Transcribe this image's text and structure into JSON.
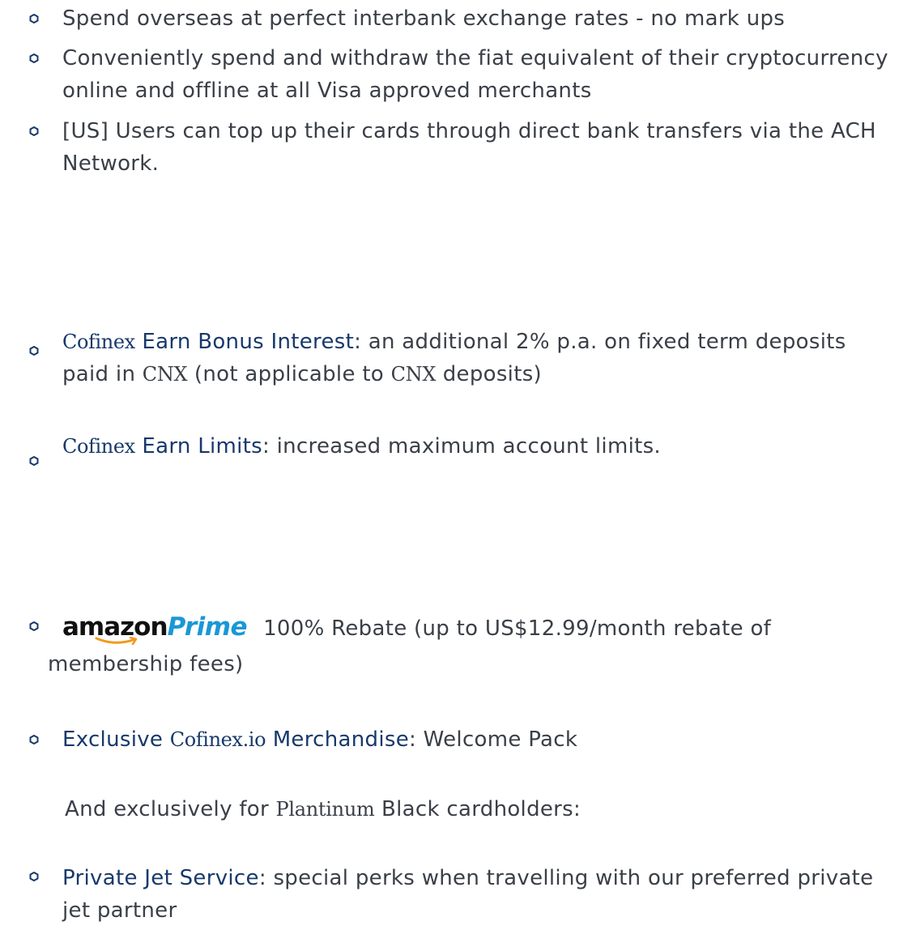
{
  "items": {
    "i1": "Spend overseas at perfect interbank exchange rates - no mark ups",
    "i2": "Conveniently spend and withdraw the fiat equivalent of their cryptocurrency online and offline at all Visa approved merchants",
    "i3": "[US] Users can top up their cards through direct bank transfers via the ACH Network.",
    "i4": {
      "brand": "Cofinex",
      "title": "Earn Bonus Interest",
      "text_a": ": an additional 2% p.a. on fixed term deposits paid in ",
      "token1": "CNX",
      "text_b": " (not applicable to ",
      "token2": "CNX",
      "text_c": " deposits)"
    },
    "i5": {
      "brand": "Cofinex",
      "title": "Earn Limits",
      "text": ": increased maximum account limits."
    },
    "i6": {
      "logo_amazon": "amazon",
      "logo_prime": "Prime",
      "text": "100% Rebate (up to US$12.99/month rebate of membership fees)"
    },
    "i7": {
      "title_a": "Exclusive",
      "brand": "Cofinex.io",
      "title_b": "Merchandise",
      "text": ": Welcome Pack"
    },
    "note": {
      "text_a": "And exclusively for ",
      "word": "Plantinum",
      "text_b": " Black cardholders:"
    },
    "i8": {
      "title": "Private Jet Service",
      "text": ": special perks when travelling with our preferred private jet partner"
    }
  },
  "colors": {
    "highlight": "#17396b",
    "bullet": "#17396b",
    "body_text": "#3a3f47",
    "prime_blue": "#1a98d5",
    "smile_orange": "#f29a1e"
  },
  "icons": {
    "bullet": "hexagon-outline-icon"
  }
}
